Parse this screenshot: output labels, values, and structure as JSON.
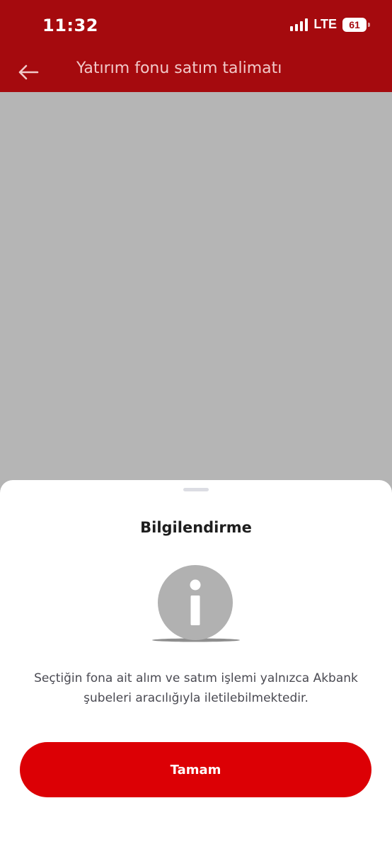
{
  "status_bar": {
    "time": "11:32",
    "network": "LTE",
    "battery": "61",
    "icons": [
      "signal-icon",
      "battery-icon"
    ]
  },
  "app_bar": {
    "title": "Yatırım fonu satım talimatı",
    "back_icon": "arrow-left-icon"
  },
  "sheet": {
    "title": "Bilgilendirme",
    "icon": "info-icon",
    "message": "Seçtiğin fona ait alım ve satım işlemi yalnızca Akbank şubeleri aracılığıyla iletilebilmektedir.",
    "button_label": "Tamam"
  },
  "colors": {
    "brand_red": "#a50a0e",
    "button_red": "#dc0005",
    "overlay": "#b5b5b5",
    "icon_gray": "#b1b1b1"
  }
}
